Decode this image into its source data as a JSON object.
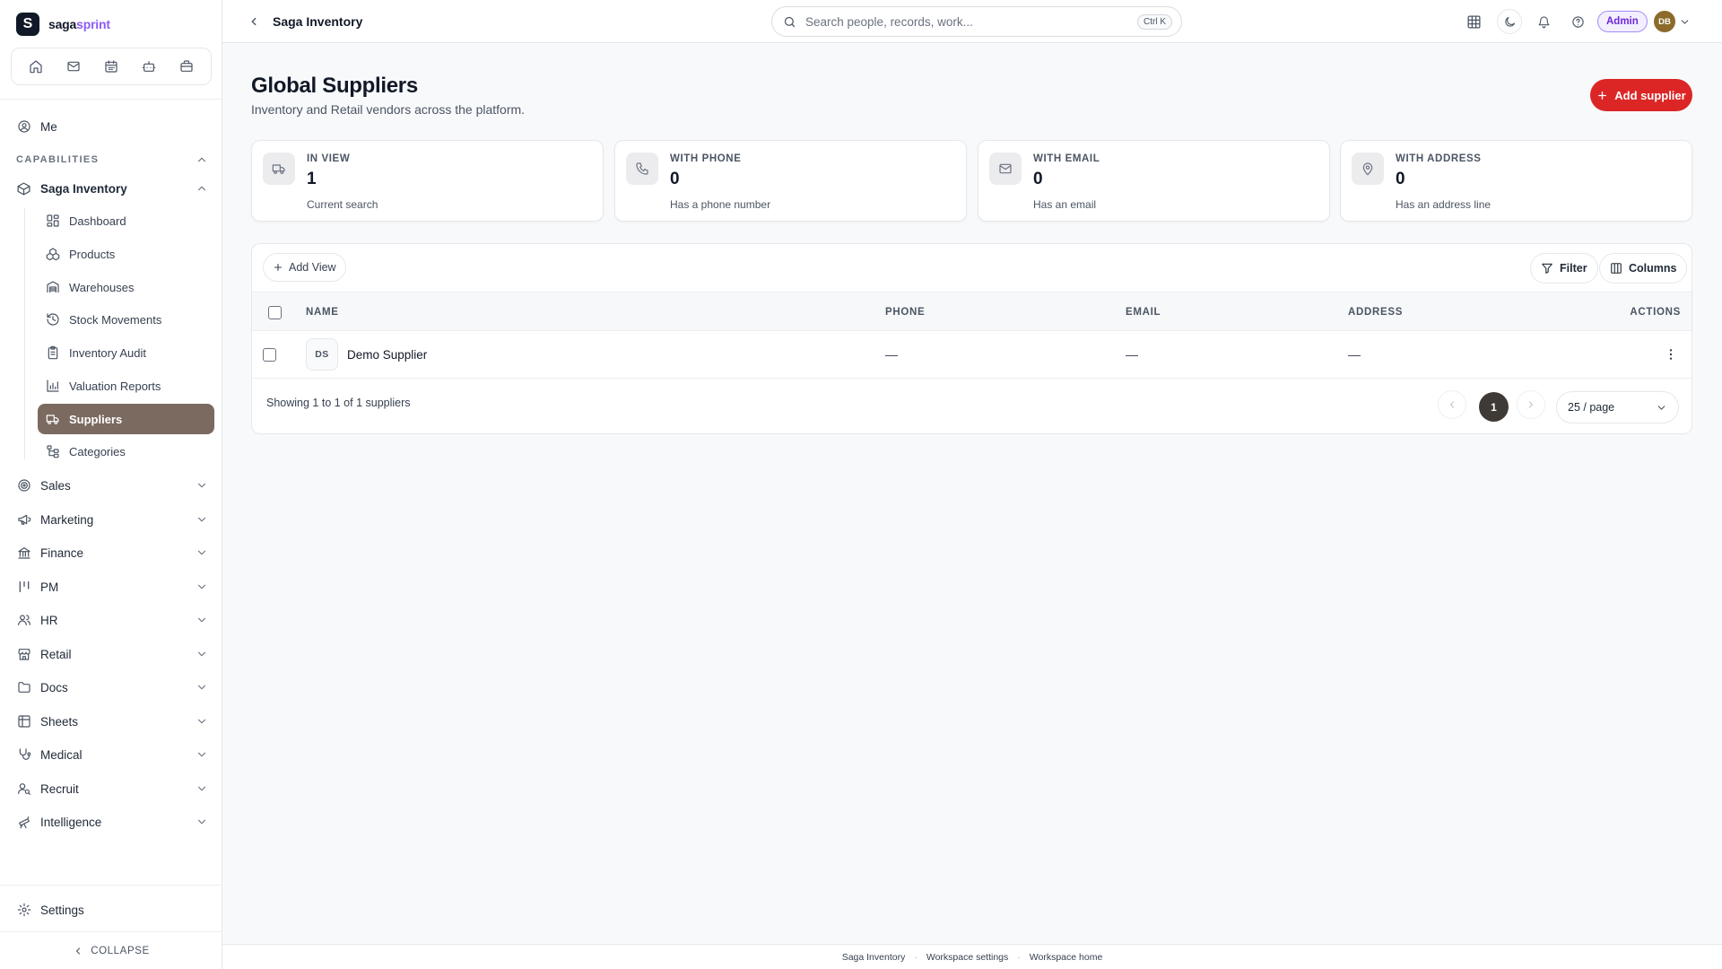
{
  "brand": {
    "name_part1": "saga",
    "name_part2": "sprint",
    "mark": "S",
    "accent_color": "#8b5cf6"
  },
  "sidebar": {
    "quick_icons": [
      "home-icon",
      "mail-icon",
      "calendar-icon",
      "bot-icon",
      "briefcase-icon"
    ],
    "me_label": "Me",
    "capabilities_label": "CAPABILITIES",
    "current_module": {
      "label": "Saga Inventory",
      "icon": "box-icon"
    },
    "sub_items": [
      {
        "label": "Dashboard",
        "icon": "dashboard-icon",
        "active": false
      },
      {
        "label": "Products",
        "icon": "products-icon",
        "active": false
      },
      {
        "label": "Warehouses",
        "icon": "warehouse-icon",
        "active": false
      },
      {
        "label": "Stock Movements",
        "icon": "history-icon",
        "active": false
      },
      {
        "label": "Inventory Audit",
        "icon": "clipboard-icon",
        "active": false
      },
      {
        "label": "Valuation Reports",
        "icon": "bar-chart-icon",
        "active": false
      },
      {
        "label": "Suppliers",
        "icon": "truck-icon",
        "active": true
      },
      {
        "label": "Categories",
        "icon": "tree-icon",
        "active": false
      }
    ],
    "modules": [
      {
        "label": "Sales",
        "icon": "target-icon"
      },
      {
        "label": "Marketing",
        "icon": "megaphone-icon"
      },
      {
        "label": "Finance",
        "icon": "bank-icon"
      },
      {
        "label": "PM",
        "icon": "kanban-icon"
      },
      {
        "label": "HR",
        "icon": "users-icon"
      },
      {
        "label": "Retail",
        "icon": "store-icon"
      },
      {
        "label": "Docs",
        "icon": "folder-icon"
      },
      {
        "label": "Sheets",
        "icon": "table-icon"
      },
      {
        "label": "Medical",
        "icon": "stethoscope-icon"
      },
      {
        "label": "Recruit",
        "icon": "user-search-icon"
      },
      {
        "label": "Intelligence",
        "icon": "telescope-icon"
      }
    ],
    "settings_label": "Settings",
    "collapse_label": "COLLAPSE",
    "active_color": "#7a6a5f"
  },
  "header": {
    "breadcrumb": "Saga Inventory",
    "search_placeholder": "Search people, records, work...",
    "search_shortcut": "Ctrl K",
    "admin_badge": "Admin",
    "avatar_initials": "DB"
  },
  "main": {
    "title": "Global Suppliers",
    "subtitle": "Inventory and Retail vendors across the platform.",
    "add_button": "Add supplier",
    "primary_color": "#dc2626",
    "stats": [
      {
        "label": "IN VIEW",
        "value": "1",
        "desc": "Current search",
        "icon": "truck-icon"
      },
      {
        "label": "WITH PHONE",
        "value": "0",
        "desc": "Has a phone number",
        "icon": "phone-icon"
      },
      {
        "label": "WITH EMAIL",
        "value": "0",
        "desc": "Has an email",
        "icon": "mail-icon"
      },
      {
        "label": "WITH ADDRESS",
        "value": "0",
        "desc": "Has an address line",
        "icon": "map-pin-icon"
      }
    ],
    "table": {
      "add_view": "Add View",
      "filter": "Filter",
      "columns_button": "Columns",
      "columns": [
        "NAME",
        "PHONE",
        "EMAIL",
        "ADDRESS",
        "ACTIONS"
      ],
      "rows": [
        {
          "initials": "DS",
          "name": "Demo Supplier",
          "phone": "—",
          "email": "—",
          "address": "—"
        }
      ],
      "showing": "Showing 1 to 1 of 1 suppliers",
      "current_page": "1",
      "per_page": "25 / page"
    }
  },
  "footer": {
    "links": [
      "Saga Inventory",
      "Workspace settings",
      "Workspace home"
    ],
    "separator": "·"
  }
}
